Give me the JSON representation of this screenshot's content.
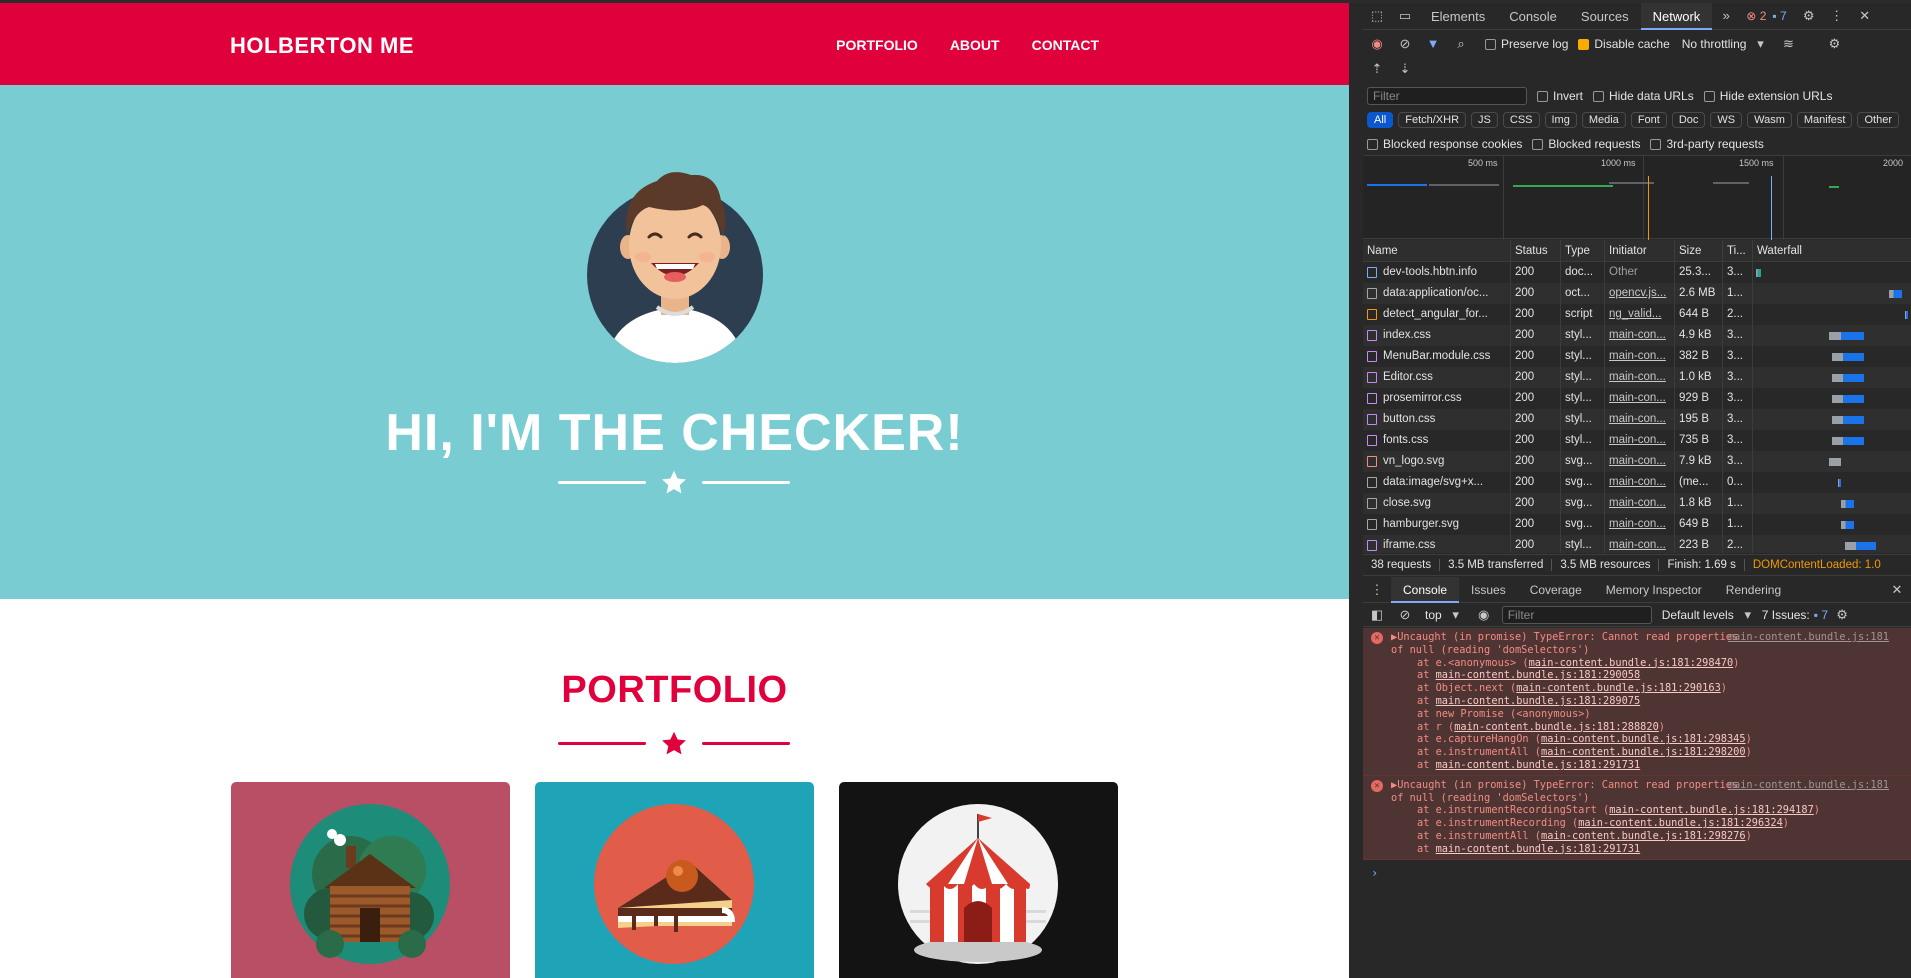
{
  "site": {
    "brand": "HOLBERTON ME",
    "nav": [
      "PORTFOLIO",
      "ABOUT",
      "CONTACT"
    ],
    "hero_title": "HI, I'M THE CHECKER!",
    "portfolio_title": "PORTFOLIO",
    "colors": {
      "nav": "#e0003c",
      "hero": "#79cdd2",
      "card1": "#b94f65",
      "card2": "#1fa3b6",
      "card3": "#131313"
    },
    "cards": [
      "cabin-icon",
      "cake-icon",
      "circus-tent-icon"
    ]
  },
  "devtools": {
    "tabs": [
      "Elements",
      "Console",
      "Sources",
      "Network"
    ],
    "active_tab": "Network",
    "error_count": "2",
    "issue_count": "7",
    "toolbar": {
      "preserve_log": "Preserve log",
      "disable_cache": "Disable cache",
      "throttling": "No throttling"
    },
    "filter_placeholder": "Filter",
    "filter_options": [
      "Invert",
      "Hide data URLs",
      "Hide extension URLs"
    ],
    "type_chips": [
      "All",
      "Fetch/XHR",
      "JS",
      "CSS",
      "Img",
      "Media",
      "Font",
      "Doc",
      "WS",
      "Wasm",
      "Manifest",
      "Other"
    ],
    "block_options": [
      "Blocked response cookies",
      "Blocked requests",
      "3rd-party requests"
    ],
    "timeline_ticks": [
      "500 ms",
      "1000 ms",
      "1500 ms",
      "2000"
    ],
    "columns": [
      "Name",
      "Status",
      "Type",
      "Initiator",
      "Size",
      "Ti...",
      "Waterfall"
    ],
    "requests": [
      {
        "name": "dev-tools.hbtn.info",
        "status": "200",
        "type": "doc...",
        "initiator": "Other",
        "size": "25.3...",
        "time": "3...",
        "icon": "doc"
      },
      {
        "name": "data:application/oc...",
        "status": "200",
        "type": "oct...",
        "initiator": "opencv.js...",
        "size": "2.6 MB",
        "time": "1...",
        "icon": "file"
      },
      {
        "name": "detect_angular_for...",
        "status": "200",
        "type": "script",
        "initiator": "ng_valid...",
        "size": "644 B",
        "time": "2...",
        "icon": "script"
      },
      {
        "name": "index.css",
        "status": "200",
        "type": "styl...",
        "initiator": "main-con...",
        "size": "4.9 kB",
        "time": "3...",
        "icon": "css"
      },
      {
        "name": "MenuBar.module.css",
        "status": "200",
        "type": "styl...",
        "initiator": "main-con...",
        "size": "382 B",
        "time": "3...",
        "icon": "css"
      },
      {
        "name": "Editor.css",
        "status": "200",
        "type": "styl...",
        "initiator": "main-con...",
        "size": "1.0 kB",
        "time": "3...",
        "icon": "css"
      },
      {
        "name": "prosemirror.css",
        "status": "200",
        "type": "styl...",
        "initiator": "main-con...",
        "size": "929 B",
        "time": "3...",
        "icon": "css"
      },
      {
        "name": "button.css",
        "status": "200",
        "type": "styl...",
        "initiator": "main-con...",
        "size": "195 B",
        "time": "3...",
        "icon": "css"
      },
      {
        "name": "fonts.css",
        "status": "200",
        "type": "styl...",
        "initiator": "main-con...",
        "size": "735 B",
        "time": "3...",
        "icon": "css"
      },
      {
        "name": "vn_logo.svg",
        "status": "200",
        "type": "svg...",
        "initiator": "main-con...",
        "size": "7.9 kB",
        "time": "3...",
        "icon": "img"
      },
      {
        "name": "data:image/svg+x...",
        "status": "200",
        "type": "svg...",
        "initiator": "main-con...",
        "size": "(me...",
        "time": "0...",
        "icon": "file"
      },
      {
        "name": "close.svg",
        "status": "200",
        "type": "svg...",
        "initiator": "main-con...",
        "size": "1.8 kB",
        "time": "1...",
        "icon": "file"
      },
      {
        "name": "hamburger.svg",
        "status": "200",
        "type": "svg...",
        "initiator": "main-con...",
        "size": "649 B",
        "time": "1...",
        "icon": "file"
      },
      {
        "name": "iframe.css",
        "status": "200",
        "type": "styl...",
        "initiator": "main-con...",
        "size": "223 B",
        "time": "2...",
        "icon": "css"
      }
    ],
    "summary": {
      "requests": "38 requests",
      "transferred": "3.5 MB transferred",
      "resources": "3.5 MB resources",
      "finish": "Finish: 1.69 s",
      "dcl": "DOMContentLoaded: 1.0"
    },
    "drawer_tabs": [
      "Console",
      "Issues",
      "Coverage",
      "Memory Inspector",
      "Rendering"
    ],
    "console_toolbar": {
      "context": "top",
      "filter_placeholder": "Filter",
      "levels": "Default levels",
      "issues": "7 Issues:",
      "issue_count": "7"
    },
    "errors": [
      {
        "message": "Uncaught (in promise) TypeError: Cannot read properties of null (reading 'domSelectors')",
        "source": "main-content.bundle.js:181",
        "stack": [
          [
            "at e.<anonymous> (",
            "main-content.bundle.js:181:298470",
            ")"
          ],
          [
            "at ",
            "main-content.bundle.js:181:290058",
            ""
          ],
          [
            "at Object.next (",
            "main-content.bundle.js:181:290163",
            ")"
          ],
          [
            "at ",
            "main-content.bundle.js:181:289075",
            ""
          ],
          [
            "at new Promise (<anonymous>)",
            "",
            ""
          ],
          [
            "at r (",
            "main-content.bundle.js:181:288820",
            ")"
          ],
          [
            "at e.captureHangOn (",
            "main-content.bundle.js:181:298345",
            ")"
          ],
          [
            "at e.instrumentAll (",
            "main-content.bundle.js:181:298200",
            ")"
          ],
          [
            "at ",
            "main-content.bundle.js:181:291731",
            ""
          ]
        ]
      },
      {
        "message": "Uncaught (in promise) TypeError: Cannot read properties of null (reading 'domSelectors')",
        "source": "main-content.bundle.js:181",
        "stack": [
          [
            "at e.instrumentRecordingStart (",
            "main-content.bundle.js:181:294187",
            ")"
          ],
          [
            "at e.instrumentRecording (",
            "main-content.bundle.js:181:296324",
            ")"
          ],
          [
            "at e.instrumentAll (",
            "main-content.bundle.js:181:298276",
            ")"
          ],
          [
            "at ",
            "main-content.bundle.js:181:291731",
            ""
          ]
        ]
      }
    ]
  }
}
